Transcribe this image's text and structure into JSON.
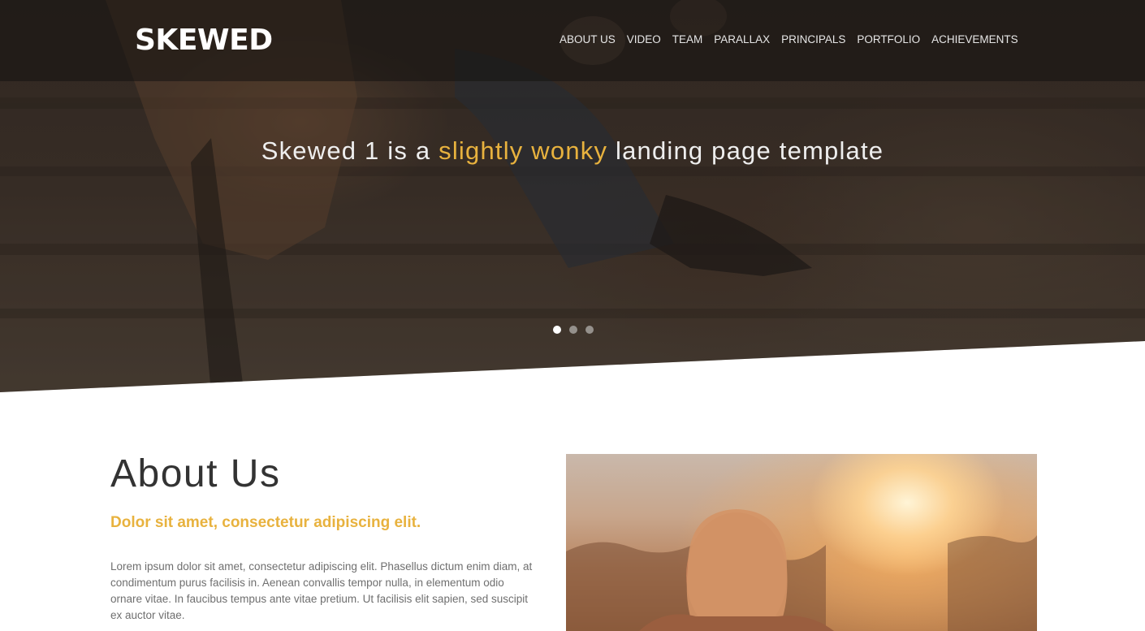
{
  "header": {
    "logo": "SKEWED",
    "nav": [
      {
        "label": "ABOUT US"
      },
      {
        "label": "VIDEO"
      },
      {
        "label": "TEAM"
      },
      {
        "label": "PARALLAX"
      },
      {
        "label": "PRINCIPALS"
      },
      {
        "label": "PORTFOLIO"
      },
      {
        "label": "ACHIEVEMENTS"
      }
    ]
  },
  "hero": {
    "headline_pre": "Skewed 1 is a ",
    "headline_accent": "slightly wonky",
    "headline_post": " landing page template",
    "slides_count": 3,
    "active_slide": 1
  },
  "about": {
    "title": "About Us",
    "subtitle": "Dolor sit amet, consectetur adipiscing elit.",
    "body": "Lorem ipsum dolor sit amet, consectetur adipiscing elit. Phasellus dictum enim diam, at condimentum purus facilisis in. Aenean convallis tempor nulla, in elementum odio ornare vitae. In faucibus tempus ante vitae pretium. Ut facilisis elit sapien, sed suscipit ex auctor vitae."
  },
  "colors": {
    "accent": "#e8b23e",
    "heading": "#333333",
    "body_text": "#6f6f6f",
    "nav_text": "#e6e6e6"
  }
}
